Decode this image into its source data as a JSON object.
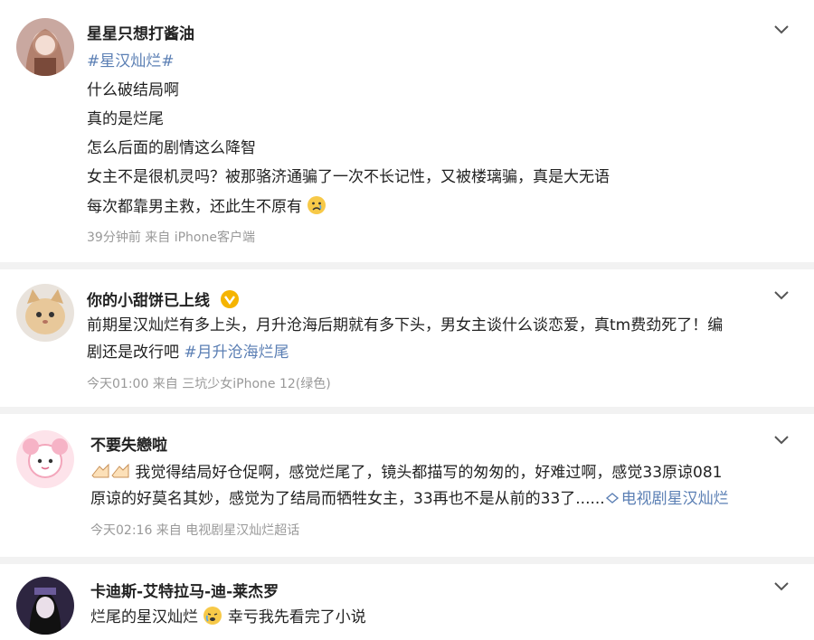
{
  "posts": [
    {
      "username": "星星只想打酱油",
      "lines": [
        "#星汉灿烂#",
        "什么破结局啊",
        "真的是烂尾",
        "怎么后面的剧情这么降智",
        "女主不是很机灵吗？被那骆济通骗了一次不长记性，又被楼璃骗，真是大无语",
        "每次都靠男主救，还此生不原有"
      ],
      "meta": "39分钟前   来自 iPhone客户端",
      "icons": {
        "avatar": "girl-avatar",
        "menu": "chevron-down-icon",
        "emoji": "sad-emoji-icon"
      }
    },
    {
      "username": "你的小甜饼已上线",
      "line1": "前期星汉灿烂有多上头，月升沧海后期就有多下头，男女主谈什么谈恋爱，真tm费劲死了！编",
      "line2_text": "剧还是改行吧 ",
      "line2_topic": "#月升沧海烂尾",
      "meta": "今天01:00   来自 三坑少女iPhone 12(绿色)",
      "icons": {
        "avatar": "cat-avatar",
        "badge": "vip-badge-icon",
        "menu": "chevron-down-icon"
      }
    },
    {
      "username": "不要失戀啦",
      "line1": "我觉得结局好仓促啊，感觉烂尾了，镜头都描写的匆匆的，好难过啊，感觉33原谅081",
      "line2_text": "原谅的好莫名其妙，感觉为了结局而牺牲女主，33再也不是从前的33了......",
      "line2_link": "电视剧星汉灿烂",
      "meta": "今天02:16   来自 电视剧星汉灿烂超话",
      "icons": {
        "avatar": "cartoon-avatar",
        "emoji": "hands-emoji-icon",
        "link": "link-icon",
        "menu": "chevron-down-icon"
      }
    },
    {
      "username": "卡迪斯-艾特拉马-迪-莱杰罗",
      "line1_a": "烂尾的星汉灿烂",
      "line1_b": "幸亏我先看完了小说",
      "icons": {
        "avatar": "anime-avatar",
        "emoji": "cry-emoji-icon",
        "menu": "chevron-down-icon"
      }
    }
  ],
  "colors": {
    "topic": "#5b7fb4",
    "meta": "#999999",
    "vip": "#f5b400"
  }
}
